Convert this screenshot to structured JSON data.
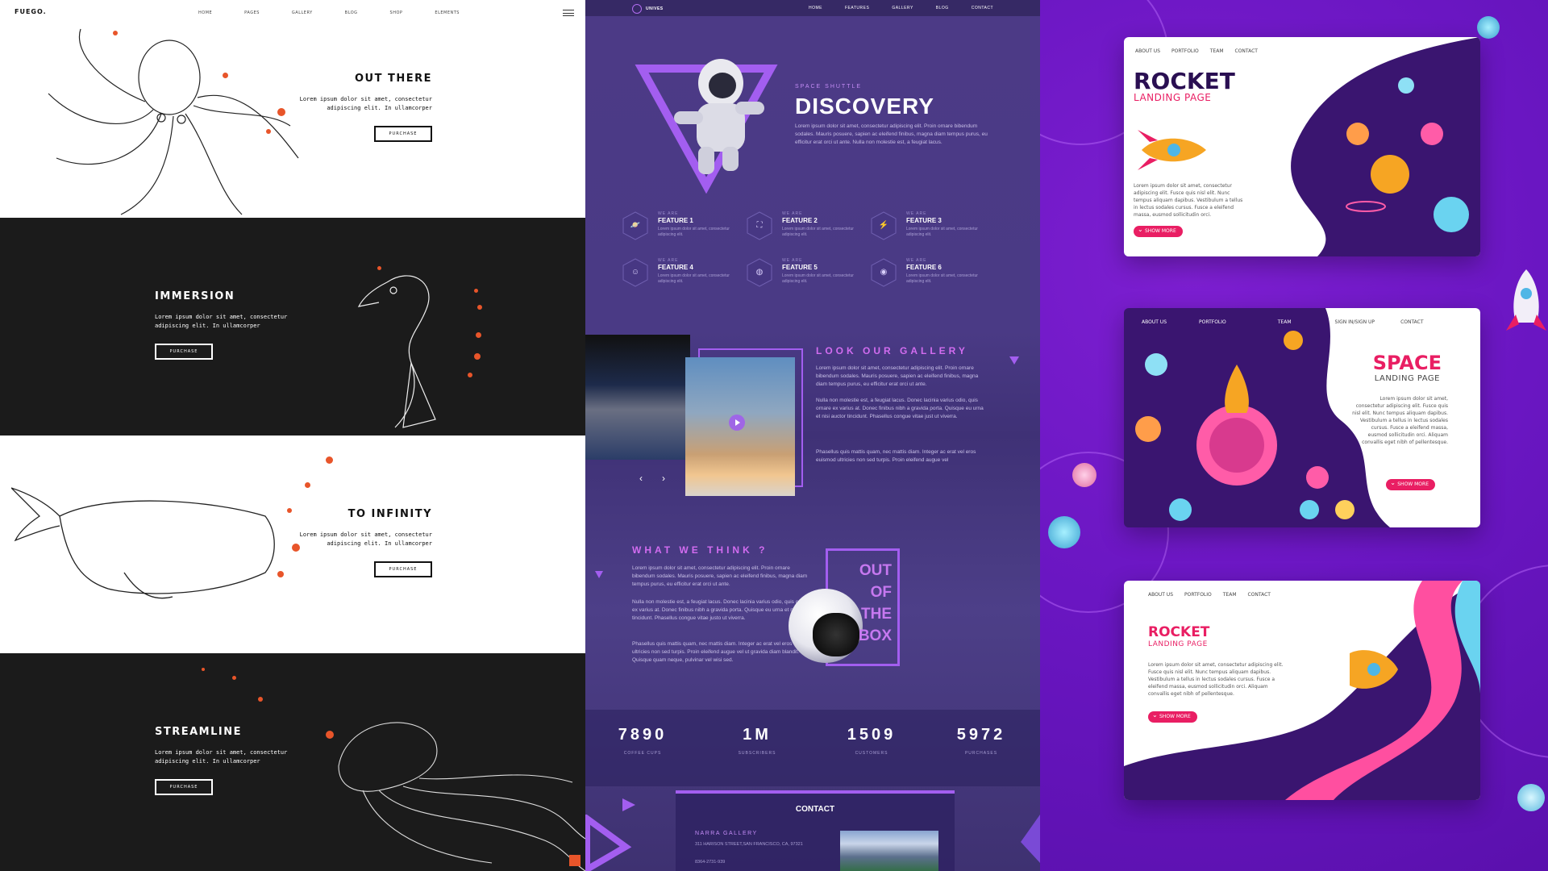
{
  "fuego": {
    "logo": "FUEGO.",
    "menu": [
      "HOME",
      "PAGES",
      "GALLERY",
      "BLOG",
      "SHOP",
      "ELEMENTS"
    ],
    "body_text": "Lorem ipsum dolor sit amet, consectetur adipiscing elit. In ullamcorper",
    "button_label": "PURCHASE",
    "sections": [
      {
        "heading": "OUT THERE",
        "illustration": "octopus"
      },
      {
        "heading": "IMMERSION",
        "illustration": "seahorse"
      },
      {
        "heading": "TO INFINITY",
        "illustration": "whale"
      },
      {
        "heading": "STREAMLINE",
        "illustration": "jellyfish"
      }
    ],
    "accent": "#e8552a"
  },
  "univers": {
    "logo": "UNIVES",
    "menu": [
      "HOME",
      "FEATURES",
      "GALLERY",
      "BLOG",
      "CONTACT"
    ],
    "hero": {
      "kicker": "SPACE SHUTTLE",
      "title": "DISCOVERY",
      "text": "Lorem ipsum dolor sit amet, consectetur adipiscing elit. Proin ornare bibendum sodales. Mauris posuere, sapien ac eleifend finibus, magna diam tempus purus, eu efficitur erat orci ut ante. Nulla non molestie est, a feugiat lacus."
    },
    "features": [
      {
        "kicker": "WE ARE",
        "name": "FEATURE 1",
        "desc": "Lorem ipsum dolor sit amet, consectetur adipiscing elit.",
        "icon": "planet-icon"
      },
      {
        "kicker": "WE ARE",
        "name": "FEATURE 2",
        "desc": "Lorem ipsum dolor sit amet, consectetur adipiscing elit.",
        "icon": "expand-icon"
      },
      {
        "kicker": "WE ARE",
        "name": "FEATURE 3",
        "desc": "Lorem ipsum dolor sit amet, consectetur adipiscing elit.",
        "icon": "bolt-icon"
      },
      {
        "kicker": "WE ARE",
        "name": "FEATURE 4",
        "desc": "Lorem ipsum dolor sit amet, consectetur adipiscing elit.",
        "icon": "astronaut-icon"
      },
      {
        "kicker": "WE ARE",
        "name": "FEATURE 5",
        "desc": "Lorem ipsum dolor sit amet, consectetur adipiscing elit.",
        "icon": "globe-icon"
      },
      {
        "kicker": "WE ARE",
        "name": "FEATURE 6",
        "desc": "Lorem ipsum dolor sit amet, consectetur adipiscing elit.",
        "icon": "signal-icon"
      }
    ],
    "gallery": {
      "title": "LOOK OUR GALLERY",
      "p1": "Lorem ipsum dolor sit amet, consectetur adipiscing elit. Proin ornare bibendum sodales. Mauris posuere, sapien ac eleifend finibus, magna diam tempus purus, eu efficitur erat orci ut ante.",
      "p2": "Nulla non molestie est, a feugiat lacus. Donec lacinia varius odio, quis ornare ex varius at. Donec finibus nibh a gravida porta. Quisque eu urna et nisi auctor tincidunt. Phasellus congue vitae just ut viverra.",
      "p3": "Phasellus quis mattis quam, nec mattis diam. Integer ac erat vel eros euismod ultricies non sed turpis. Proin eleifend augue vel",
      "prev": "‹",
      "next": "›"
    },
    "think": {
      "title": "WHAT WE THINK ?",
      "p1": "Lorem ipsum dolor sit amet, consectetur adipiscing elit. Proin ornare bibendum sodales. Mauris posuere, sapien ac eleifend finibus, magna diam tempus purus, eu efficitur erat orci ut ante.",
      "p2": "Nulla non molestie est, a feugiat lacus. Donec lacinia varius odio, quis ornare ex varius at. Donec finibus nibh a gravida porta. Quisque eu urna et nisi auctor tincidunt. Phasellus congue vitae justo ut viverra.",
      "p3": "Phasellus quis mattis quam, nec mattis diam. Integer ac erat vel eros euismod ultricies non sed turpis. Proin eleifend augue vel ut gravida diam blandit. Quisque quam neque, pulvinar vel wisi sed.",
      "box": [
        "OUT",
        "OF",
        "THE",
        "BOX"
      ]
    },
    "stats": [
      {
        "num": "7890",
        "label": "COFFEE CUPS"
      },
      {
        "num": "1M",
        "label": "SUBSCRIBERS"
      },
      {
        "num": "1509",
        "label": "CUSTOMERS"
      },
      {
        "num": "5972",
        "label": "PURCHASES"
      }
    ],
    "contact": {
      "title": "CONTACT",
      "gallery_name": "NARRA GALLERY",
      "address": "311 HARISON STREET,SAN FRANCISCO, CA, 97321",
      "phone": "8364-2731-939"
    },
    "accent": "#a35ef0"
  },
  "landing": {
    "card1": {
      "nav": [
        "ABOUT US",
        "PORTFOLIO",
        "TEAM",
        "CONTACT"
      ],
      "title": "ROCKET",
      "subtitle": "LANDING PAGE",
      "text": "Lorem ipsum dolor sit amet, consectetur adipiscing elit. Fusce quis nisl elit. Nunc tempus aliquam dapibus. Vestibulum a tellus in lectus sodales cursus. Fusce a eleifend massa, eusmod sollicitudin orci.",
      "button": "SHOW MORE"
    },
    "card2": {
      "nav": [
        "ABOUT US",
        "PORTFOLIO",
        "TEAM",
        "SIGN IN/SIGN UP",
        "CONTACT"
      ],
      "title": "SPACE",
      "subtitle": "LANDING PAGE",
      "text": "Lorem ipsum dolor sit amet, consectetur adipiscing elit. Fusce quis nisl elit. Nunc tempus aliquam dapibus. Vestibulum a tellus in lectus sodales cursus. Fusce a eleifend massa, eusmod sollicitudin orci. Aliquam convallis eget nibh of pellentesque.",
      "button": "SHOW MORE"
    },
    "card3": {
      "nav": [
        "ABOUT US",
        "PORTFOLIO",
        "TEAM",
        "CONTACT"
      ],
      "title": "ROCKET",
      "subtitle": "LANDING PAGE",
      "text": "Lorem ipsum dolor sit amet, consectetur adipiscing elit. Fusce quis nisl elit. Nunc tempus aliquam dapibus. Vestibulum a tellus in lectus sodales cursus. Fusce a eleifend massa, eusmod sollicitudin orci. Aliquam convallis eget nibh of pellentesque.",
      "button": "SHOW MORE"
    },
    "bg_color": "#6a16c2",
    "pink": "#e91e63"
  }
}
